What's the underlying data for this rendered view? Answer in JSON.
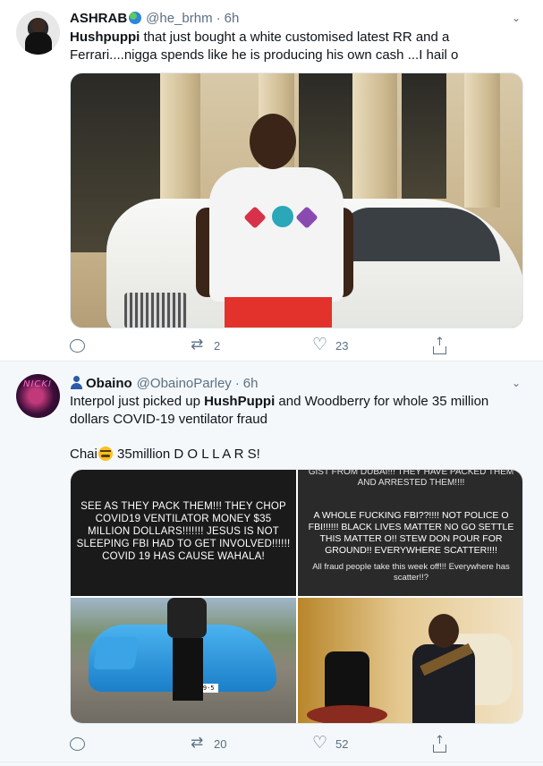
{
  "tweets": [
    {
      "name": "ASHRAB",
      "handle": "@he_brhm",
      "separator": "·",
      "time": "6h",
      "text_bold": "Hushpuppi",
      "text_rest": " that just bought a white customised latest RR and a Ferrari....nigga spends like he is producing his own cash ...I hail o",
      "retweets": "2",
      "likes": "23"
    },
    {
      "name": "Obaino",
      "handle": "@ObainoParley",
      "separator": "·",
      "time": "6h",
      "text_pre": "Interpol just picked up ",
      "text_bold": "HushPuppi",
      "text_post": " and Woodberry for  whole 35 million dollars COVID-19 ventilator fraud",
      "line2_pre": "Chai",
      "line2_post": " 35million D O L L A R S!",
      "retweets": "20",
      "likes": "52",
      "images": {
        "img1_text": "SEE AS THEY PACK THEM!!! THEY CHOP COVID19 VENTILATOR MONEY $35 MILLION DOLLARS!!!!!!! JESUS IS NOT SLEEPING FBI HAD TO GET INVOLVED!!!!!! COVID 19 HAS CAUSE WAHALA!",
        "img2_top": "GIST FROM DUBAI!!! THEY HAVE PACKED THEM AND ARRESTED THEM!!!!",
        "img2_mid": "A WHOLE FUCKING FBI??!!!! NOT POLICE O FBI!!!!!! BLACK LIVES MATTER NO GO SETTLE THIS MATTER O!! STEW DON POUR FOR GROUND!! EVERYWHERE SCATTER!!!!",
        "img2_low": "All fraud people take this week off!!! Everywhere has scatter!!?",
        "plate": "509-5",
        "avatar_text": "NICKI"
      }
    }
  ],
  "colors": {
    "secondary_text": "#5b7083",
    "second_tweet_bg": "#f5f8fa",
    "divider": "#e6ecf0"
  },
  "icons": [
    "chevron-down-icon",
    "reply-icon",
    "retweet-icon",
    "like-icon",
    "share-icon",
    "globe-icon",
    "person-icon",
    "face-emoji-icon"
  ]
}
